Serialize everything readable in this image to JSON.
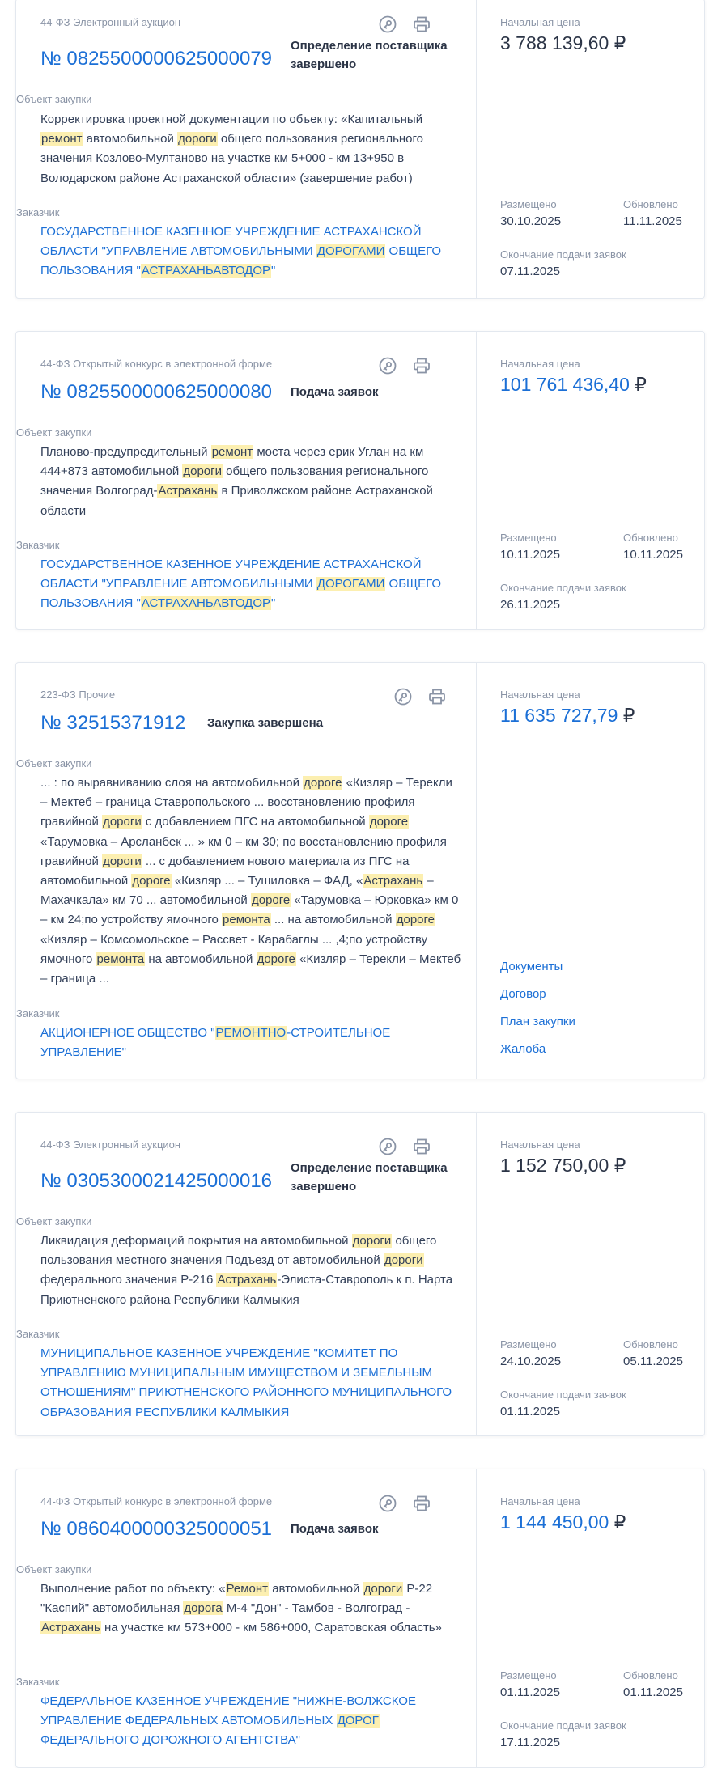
{
  "labels": {
    "object": "Объект закупки",
    "customer": "Заказчик",
    "start_price": "Начальная цена",
    "posted": "Размещено",
    "updated": "Обновлено",
    "deadline": "Окончание подачи заявок"
  },
  "icons": [
    "key-icon",
    "print-icon"
  ],
  "cards": [
    {
      "tag": "44-ФЗ Электронный аукцион",
      "number": "№ 0825500000625000079",
      "status": "Определение поставщика завершено",
      "object_html": "Корректировка проектной документации по объекту: «Капитальный <mark>ремонт</mark> автомобильной <mark>дороги</mark> общего пользования регионального значения Козлово-Мултаново на участке км 5+000 - км 13+950 в Володарском районе Астраханской области» (завершение работ)",
      "customer_html": "ГОСУДАРСТВЕННОЕ КАЗЕННОЕ УЧРЕЖДЕНИЕ АСТРАХАНСКОЙ ОБЛАСТИ \"УПРАВЛЕНИЕ АВТОМОБИЛЬНЫМИ <mark>ДОРОГАМИ</mark> ОБЩЕГО ПОЛЬЗОВАНИЯ \"<mark>АСТРАХАНЬАВТОДОР</mark>\"",
      "price": "3 788 139,60",
      "currency": "₽",
      "posted": "30.10.2025",
      "updated": "11.11.2025",
      "deadline": "07.11.2025"
    },
    {
      "tag": "44-ФЗ Открытый конкурс в электронной форме",
      "number": "№ 0825500000625000080",
      "status": "Подача заявок",
      "object_html": "Планово-предупредительный <mark>ремонт</mark> моста через ерик Углан на км 444+873 автомобильной <mark>дороги</mark> общего пользования регионального значения Волгоград-<mark>Астрахань</mark> в Приволжском районе Астраханской области",
      "customer_html": "ГОСУДАРСТВЕННОЕ КАЗЕННОЕ УЧРЕЖДЕНИЕ АСТРАХАНСКОЙ ОБЛАСТИ \"УПРАВЛЕНИЕ АВТОМОБИЛЬНЫМИ <mark>ДОРОГАМИ</mark> ОБЩЕГО ПОЛЬЗОВАНИЯ \"<mark>АСТРАХАНЬАВТОДОР</mark>\"",
      "price": "101 761 436,40",
      "currency": "₽",
      "posted": "10.11.2025",
      "updated": "10.11.2025",
      "deadline": "26.11.2025"
    },
    {
      "tag": "223-ФЗ Прочие",
      "number": "№ 32515371912",
      "status": "Закупка завершена",
      "object_html": "... : по выравниванию слоя на автомобильной <mark>дороге</mark> «Кизляр – Терекли – Мектеб – граница Ставропольского ... восстановлению профиля гравийной <mark>дороги</mark> с добавлением ПГС на автомобильной <mark>дороге</mark> «Тарумовка – Арсланбек ... » км 0 – км 30; по восстановлению профиля гравийной <mark>дороги</mark> ... с добавлением нового материала из ПГС на автомобильной <mark>дороге</mark> «Кизляр ... – Тушиловка – ФАД, «<mark>Астрахань</mark> – Махачкала» км 70 ... автомобильной <mark>дороге</mark> «Тарумовка – Юрковка» км 0 – км 24;по устройству ямочного <mark>ремонта</mark> ... на автомобильной <mark>дороге</mark> «Кизляр – Комсомольское – Рассвет - Карабаглы ... ,4;по устройству ямочного <mark>ремонта</mark> на автомобильной <mark>дороге</mark> «Кизляр – Терекли – Мектеб – граница ...",
      "customer_html": "АКЦИОНЕРНОЕ ОБЩЕСТВО \"<mark>РЕМОНТНО</mark>-СТРОИТЕЛЬНОЕ УПРАВЛЕНИЕ\"",
      "price": "11 635 727,79",
      "currency": "₽",
      "links": [
        "Документы",
        "Договор",
        "План закупки",
        "Жалоба"
      ]
    },
    {
      "tag": "44-ФЗ Электронный аукцион",
      "number": "№ 0305300021425000016",
      "status": "Определение поставщика завершено",
      "object_html": "Ликвидация деформаций покрытия на автомобильной <mark>дороги</mark> общего пользования местного значения Подъезд от автомобильной <mark>дороги</mark> федерального значения Р-216 <mark>Астрахань</mark>-Элиста-Ставрополь к п. Нарта Приютненского района Республики Калмыкия",
      "customer_html": "МУНИЦИПАЛЬНОЕ КАЗЕННОЕ УЧРЕЖДЕНИЕ \"КОМИТЕТ ПО УПРАВЛЕНИЮ МУНИЦИПАЛЬНЫМ ИМУЩЕСТВОМ И ЗЕМЕЛЬНЫМ ОТНОШЕНИЯМ\" ПРИЮТНЕНСКОГО РАЙОННОГО МУНИЦИПАЛЬНОГО ОБРАЗОВАНИЯ РЕСПУБЛИКИ КАЛМЫКИЯ",
      "price": "1 152 750,00",
      "currency": "₽",
      "posted": "24.10.2025",
      "updated": "05.11.2025",
      "deadline": "01.11.2025"
    },
    {
      "tag": "44-ФЗ Открытый конкурс в электронной форме",
      "number": "№ 0860400000325000051",
      "status": "Подача заявок",
      "object_html": "Выполнение работ по объекту: «<mark>Ремонт</mark> автомобильной <mark>дороги</mark> Р-22 \"Каспий\" автомобильная <mark>дорога</mark> М-4 \"Дон\" - Тамбов - Волгоград - <mark>Астрахань</mark> на участке км 573+000 - км 586+000, Саратовская область»",
      "customer_html": "ФЕДЕРАЛЬНОЕ КАЗЕННОЕ УЧРЕЖДЕНИЕ \"НИЖНЕ-ВОЛЖСКОЕ УПРАВЛЕНИЕ ФЕДЕРАЛЬНЫХ АВТОМОБИЛЬНЫХ <mark>ДОРОГ</mark> ФЕДЕРАЛЬНОГО ДОРОЖНОГО АГЕНТСТВА\"",
      "price": "1 144 450,00",
      "currency": "₽",
      "posted": "01.11.2025",
      "updated": "01.11.2025",
      "deadline": "17.11.2025"
    }
  ]
}
